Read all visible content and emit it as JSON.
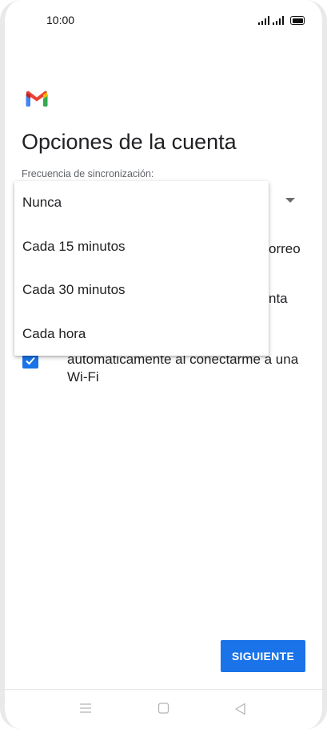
{
  "status_bar": {
    "time": "10:00"
  },
  "app": {
    "logo_icon": "gmail-logo"
  },
  "page": {
    "title": "Opciones de la cuenta",
    "sync_label": "Frecuencia de sincronización:",
    "hidden_text_1": "orreo",
    "hidden_text_2": "nta",
    "checkbox_label": "automaticamente al conectarme a una Wi-Fi",
    "checkbox_checked": true
  },
  "dropdown": {
    "options": [
      "Nunca",
      "Cada 15 minutos",
      "Cada 30 minutos",
      "Cada hora"
    ]
  },
  "footer": {
    "next_label": "SIGUIENTE"
  },
  "nav_bar": {
    "icons": [
      "menu-icon",
      "home-icon",
      "back-icon"
    ]
  },
  "colors": {
    "accent": "#1a73e8",
    "text": "#202124",
    "secondary_text": "#5f6368"
  }
}
